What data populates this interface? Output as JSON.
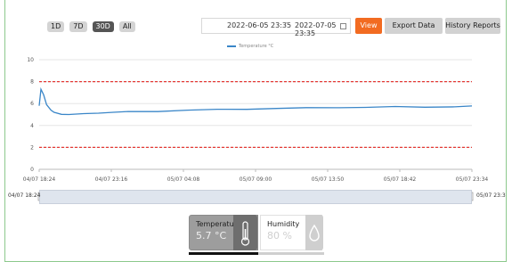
{
  "range_buttons": [
    "1D",
    "7D",
    "30D",
    "All"
  ],
  "active_range_index": 2,
  "date_range": {
    "start": "2022-06-05 23:35",
    "separator": "~",
    "end": "2022-07-05 23:35"
  },
  "actions": {
    "view": "View",
    "export": "Export Data",
    "history": "History Reports"
  },
  "colors": {
    "accent": "#f26b21",
    "series": "#3a86c8",
    "threshold": "#e53935"
  },
  "icons": {
    "calendar": "calendar-icon",
    "thermometer": "thermometer-icon",
    "droplet": "droplet-icon"
  },
  "chart_data": {
    "type": "line",
    "legend": "Temperature °C",
    "ylim": [
      0,
      10
    ],
    "y_ticks": [
      "0",
      "2",
      "4",
      "6",
      "8",
      "10"
    ],
    "x_ticks": [
      "04/07 18:24",
      "04/07 23:16",
      "05/07 04:08",
      "05/07 09:00",
      "05/07 13:50",
      "05/07 18:42",
      "05/07 23:34"
    ],
    "thresholds": [
      8,
      2
    ],
    "series": [
      {
        "name": "Temperature °C",
        "x": [
          0,
          0.12,
          0.3,
          0.5,
          0.8,
          1.0,
          1.5,
          2.0,
          3.0,
          4.0,
          5.0,
          6.0,
          8.0,
          10.0,
          12.0,
          14.0,
          16.0,
          18.0,
          20.0,
          22.0,
          24.0,
          26.0,
          28.0,
          29.17
        ],
        "y": [
          5.8,
          7.3,
          6.8,
          5.9,
          5.4,
          5.2,
          5.05,
          5.0,
          5.05,
          5.15,
          5.2,
          5.25,
          5.3,
          5.4,
          5.45,
          5.5,
          5.55,
          5.6,
          5.65,
          5.65,
          5.7,
          5.7,
          5.7,
          5.75
        ]
      }
    ]
  },
  "navigator": {
    "start_label": "04/07 18:24",
    "end_label": "05/07 23:3"
  },
  "sensors": [
    {
      "title": "Temperature",
      "value": "5.7 °C",
      "active": true
    },
    {
      "title": "Humidity",
      "value": "80 %",
      "active": false
    }
  ]
}
